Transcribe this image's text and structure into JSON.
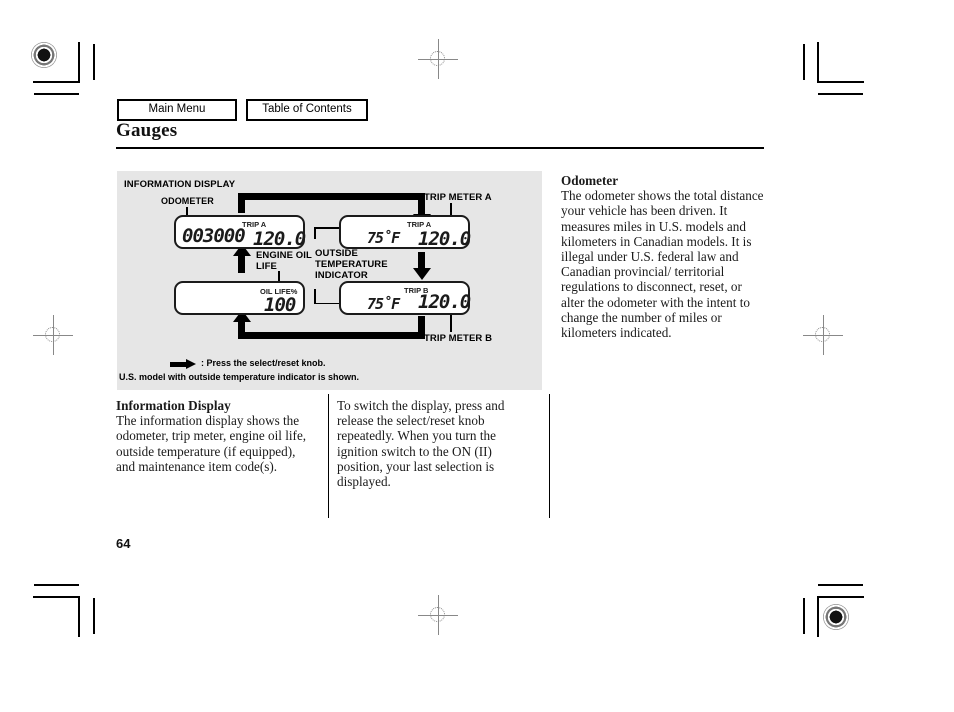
{
  "nav": {
    "main_menu": "Main Menu",
    "table_of_contents": "Table of Contents"
  },
  "page": {
    "title": "Gauges",
    "number": "64"
  },
  "figure": {
    "heading": "INFORMATION DISPLAY",
    "labels": {
      "odometer": "ODOMETER",
      "trip_meter_a": "TRIP METER A",
      "trip_meter_b": "TRIP METER B",
      "engine_oil_life": "ENGINE OIL\nLIFE",
      "outside_temperature_indicator": "OUTSIDE\nTEMPERATURE\nINDICATOR"
    },
    "displays": {
      "odometer_panel": {
        "odometer_value": "003000",
        "trip_tag": "TRIP A",
        "trip_value": "120.0"
      },
      "trip_a_panel": {
        "temperature": "75˚F",
        "trip_tag": "TRIP A",
        "trip_value": "120.0"
      },
      "oil_life_panel": {
        "oil_tag": "OIL LIFE%",
        "oil_value": "100"
      },
      "trip_b_panel": {
        "temperature": "75˚F",
        "trip_tag": "TRIP  B",
        "trip_value": "120.0"
      }
    },
    "caption_line1": ": Press the select/reset knob.",
    "caption_line2": "U.S. model with outside temperature indicator is shown."
  },
  "content": {
    "odometer": {
      "heading": "Odometer",
      "body": "The odometer shows the total distance your vehicle has been driven. It measures miles in U.S. models and kilometers in Canadian models. It is illegal under U.S. federal law and Canadian provincial/ territorial regulations to disconnect, reset, or alter the odometer with the intent to change the number of miles or kilometers indicated."
    },
    "information_display": {
      "heading": "Information Display",
      "body": "The information display shows the odometer, trip meter, engine oil life, outside temperature (if equipped), and maintenance item code(s)."
    },
    "switch_display": {
      "body": "To switch the display, press and release the select/reset knob repeatedly. When you turn the ignition switch to the ON (II) position, your last selection is displayed."
    }
  }
}
